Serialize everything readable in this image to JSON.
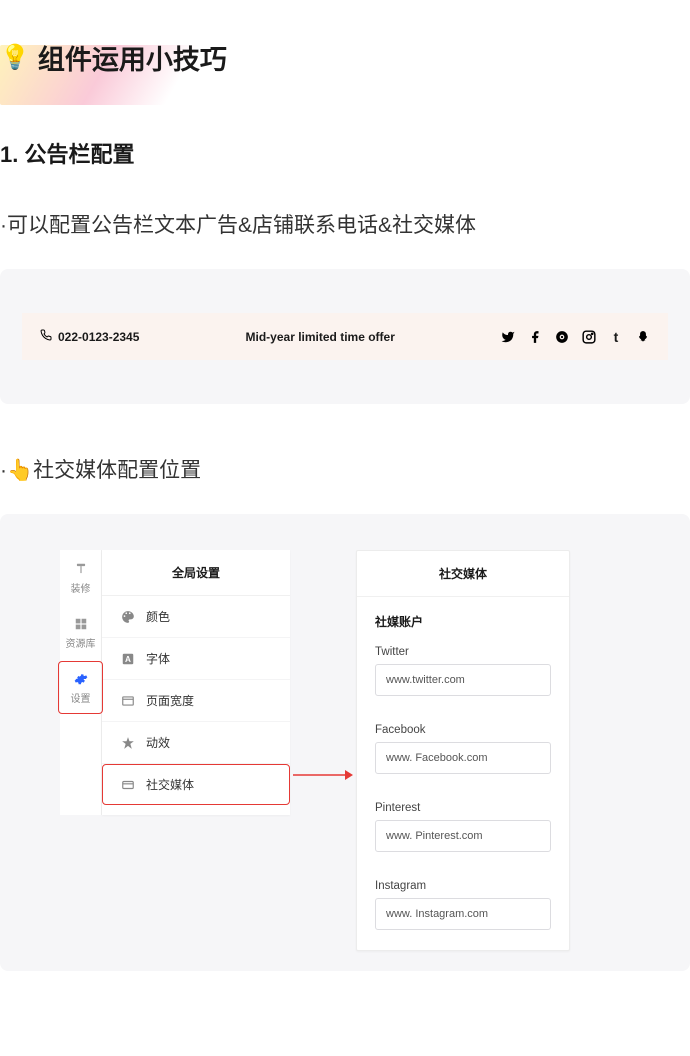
{
  "title": "组件运用小技巧",
  "section1_heading": "1. 公告栏配置",
  "bullet1": "·可以配置公告栏文本广告&店铺联系电话&社交媒体",
  "announce": {
    "phone": "022-0123-2345",
    "center": "Mid-year limited time offer"
  },
  "bullet2": "·👆社交媒体配置位置",
  "rail": {
    "item1": "装修",
    "item2": "资源库",
    "item3": "设置"
  },
  "settings": {
    "title": "全局设置",
    "items": {
      "color": "颜色",
      "font": "字体",
      "pagewidth": "页面宽度",
      "effects": "动效",
      "social": "社交媒体"
    }
  },
  "sm": {
    "title": "社交媒体",
    "subtitle": "社媒账户",
    "fields": [
      {
        "label": "Twitter",
        "value": "www.twitter.com"
      },
      {
        "label": "Facebook",
        "value": "www. Facebook.com"
      },
      {
        "label": "Pinterest",
        "value": "www. Pinterest.com"
      },
      {
        "label": "Instagram",
        "value": "www. Instagram.com"
      }
    ]
  }
}
